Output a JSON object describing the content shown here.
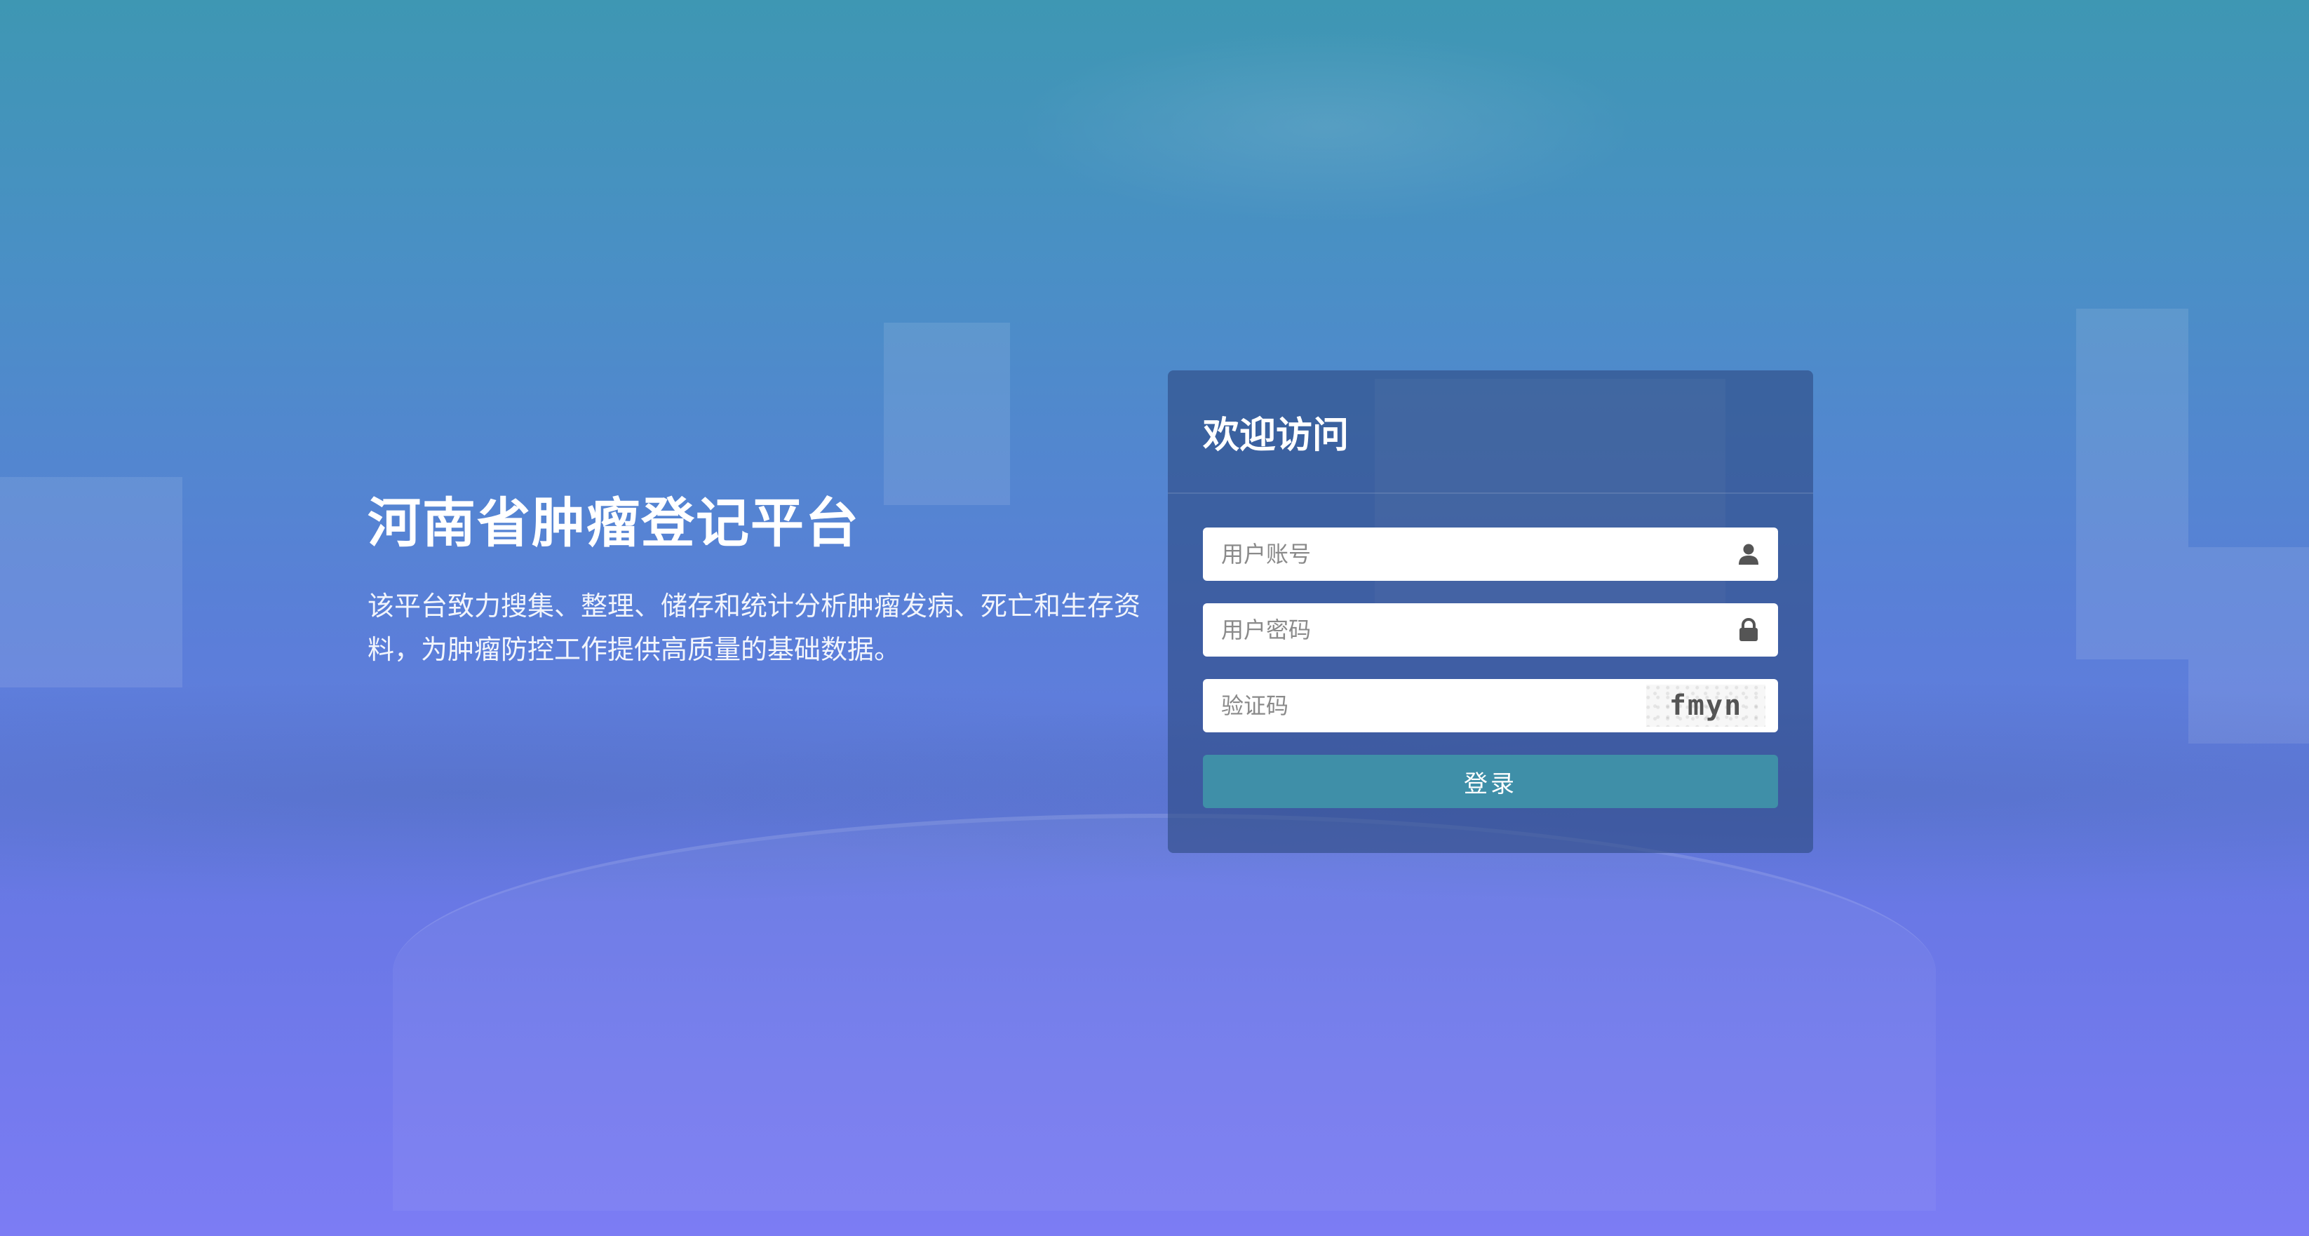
{
  "platform": {
    "title": "河南省肿瘤登记平台",
    "description": "该平台致力搜集、整理、储存和统计分析肿瘤发病、死亡和生存资料，为肿瘤防控工作提供高质量的基础数据。"
  },
  "login": {
    "heading": "欢迎访问",
    "username_placeholder": "用户账号",
    "password_placeholder": "用户密码",
    "captcha_placeholder": "验证码",
    "captcha_text": "fmyn",
    "submit_label": "登录",
    "username_icon": "user-icon",
    "password_icon": "lock-icon"
  },
  "colors": {
    "button": "#3f8fa8",
    "card": "rgba(45,75,130,0.62)"
  }
}
